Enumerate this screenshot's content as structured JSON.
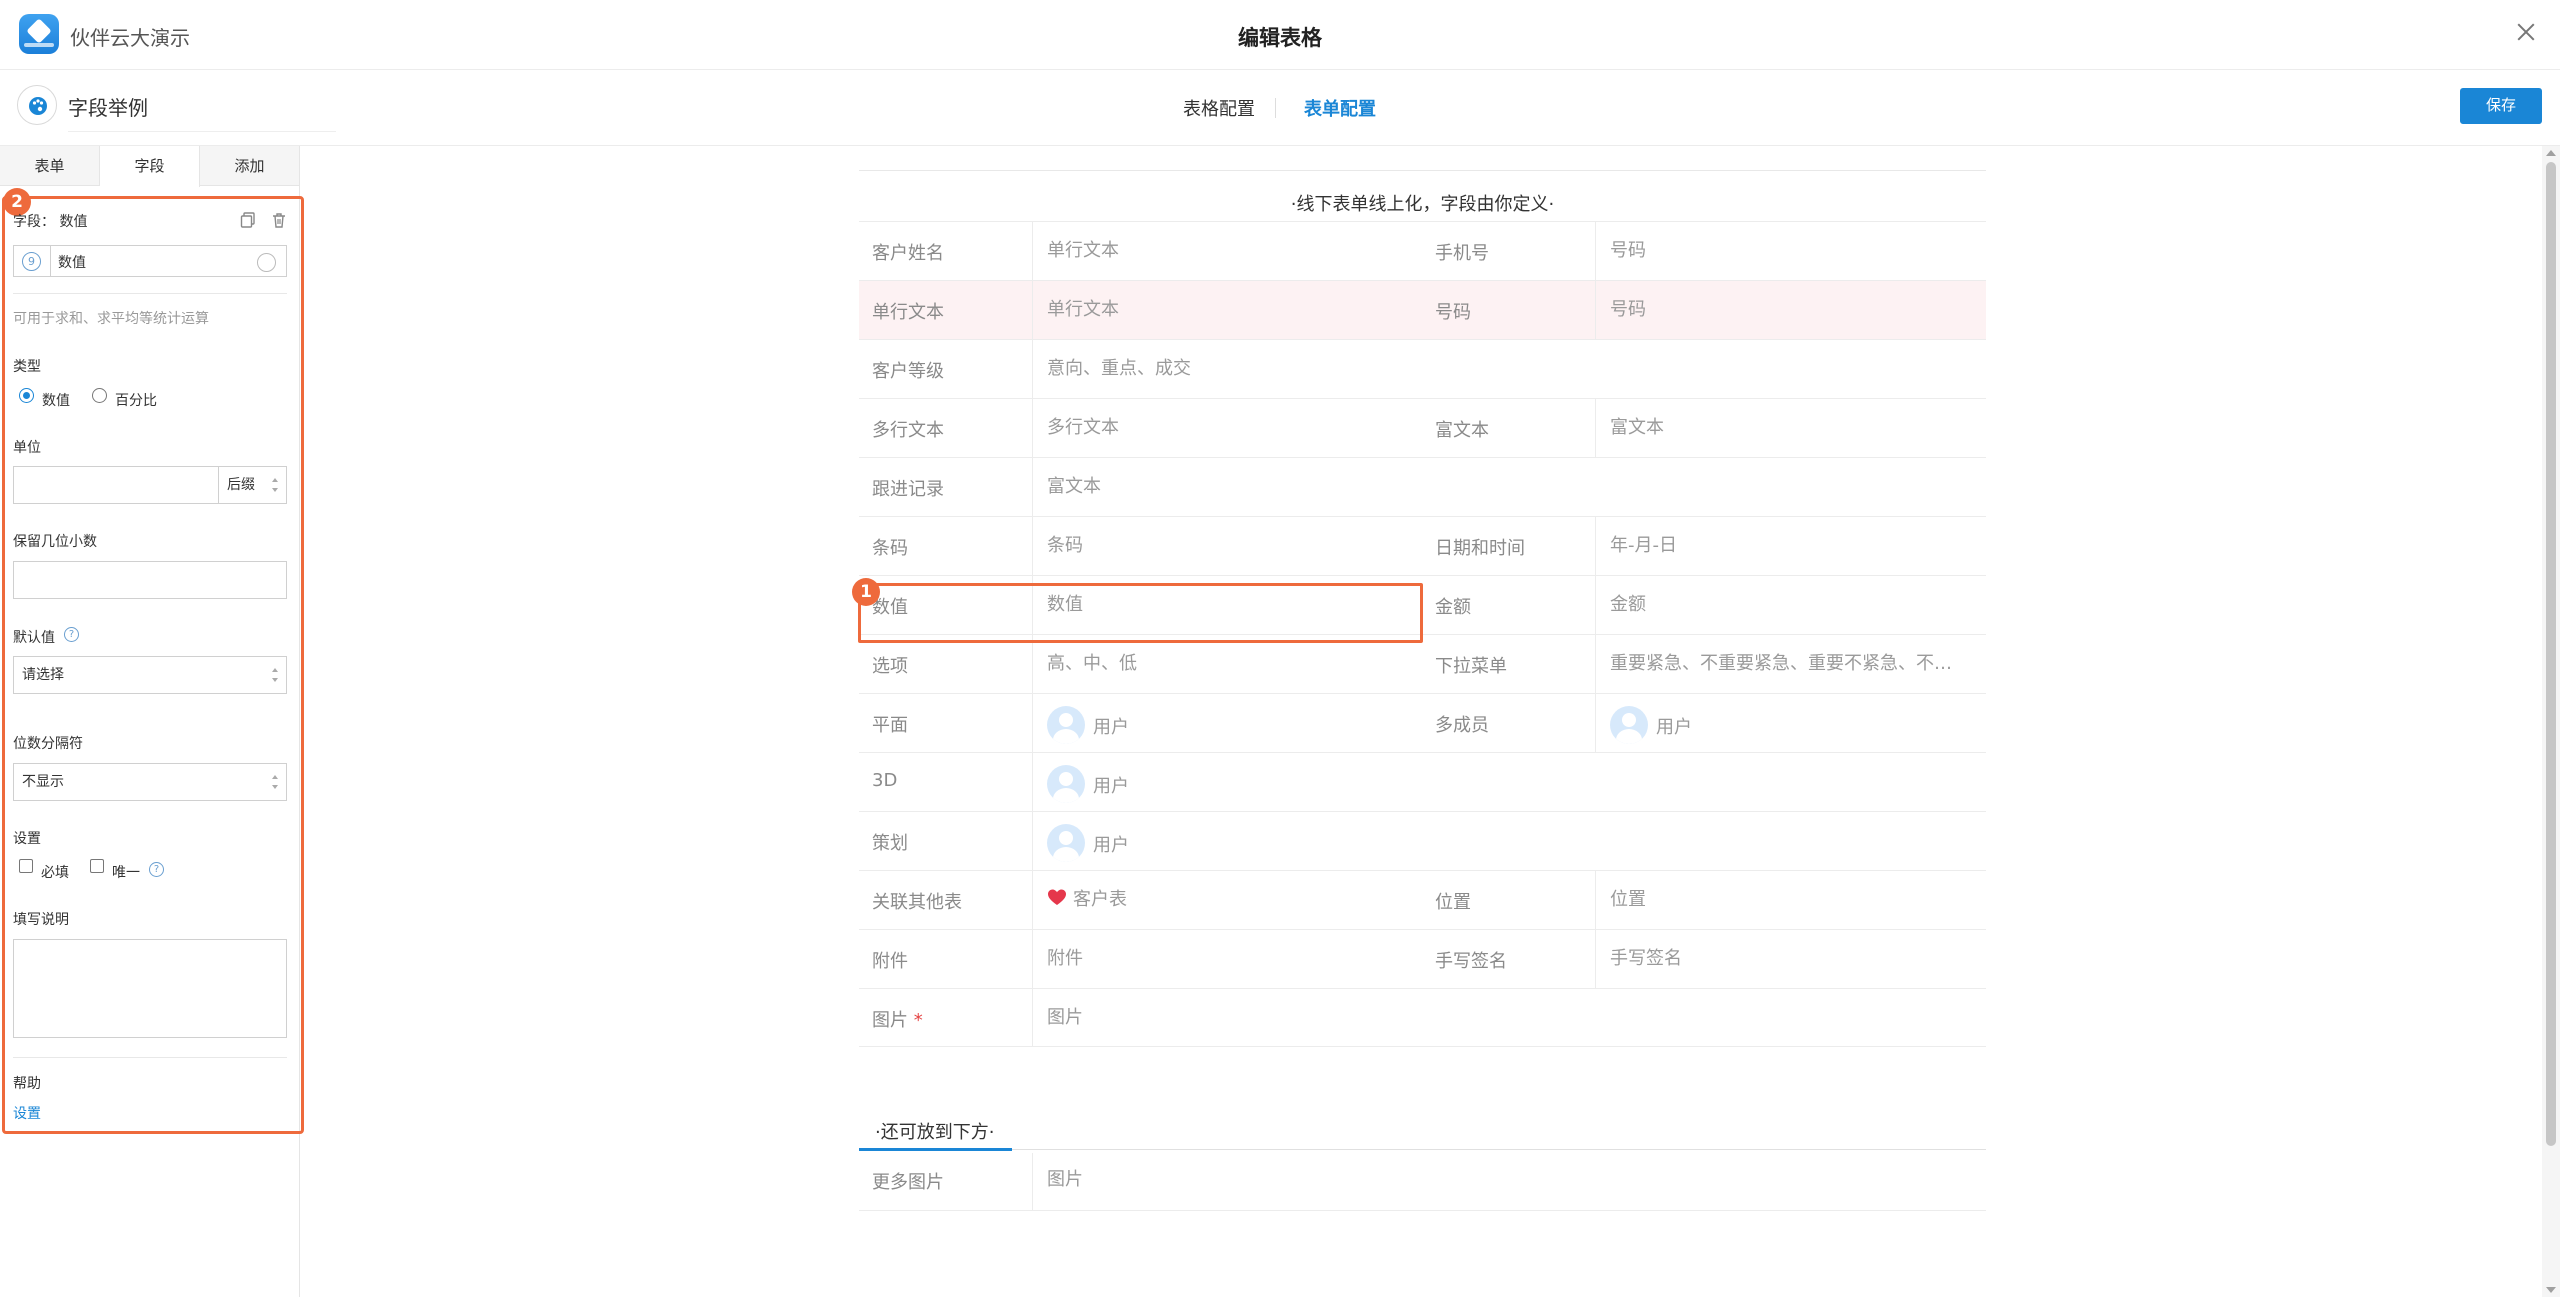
{
  "app": {
    "name": "伙伴云大演示",
    "window_title": "编辑表格"
  },
  "form": {
    "name": "字段举例"
  },
  "mode_tabs": [
    {
      "label": "表格配置"
    },
    {
      "label": "表单配置"
    }
  ],
  "save_label": "保存",
  "panel_tabs": [
    {
      "label": "表单"
    },
    {
      "label": "字段"
    },
    {
      "label": "添加"
    }
  ],
  "field_panel": {
    "badge": "2",
    "field_heading": "字段：  数值",
    "field_name": "数值",
    "field_type_glyph": "9",
    "hint": "可用于求和、求平均等统计运算",
    "type_label": "类型",
    "type_options": [
      {
        "label": "数值",
        "checked": true
      },
      {
        "label": "百分比",
        "checked": false
      }
    ],
    "unit_label": "单位",
    "unit_value": "",
    "unit_position": "后缀",
    "decimals_label": "保留几位小数",
    "decimals_value": "",
    "default_label": "默认值",
    "default_value": "请选择",
    "separator_label": "位数分隔符",
    "separator_value": "不显示",
    "settings_label": "设置",
    "settings_options": [
      {
        "label": "必填",
        "checked": false
      },
      {
        "label": "唯一",
        "checked": false
      }
    ],
    "description_label": "填写说明",
    "description_value": "",
    "help_label": "帮助",
    "help_link": "设置"
  },
  "section_title": "·线下表单线上化，字段由你定义·",
  "highlight_badge": "1",
  "rows": [
    {
      "cells": [
        {
          "label": "客户姓名",
          "value": "单行文本"
        },
        {
          "label": "手机号",
          "value": "号码"
        }
      ]
    },
    {
      "pink": true,
      "cells": [
        {
          "label": "单行文本",
          "value": "单行文本"
        },
        {
          "label": "号码",
          "value": "号码"
        }
      ]
    },
    {
      "cells": [
        {
          "label": "客户等级",
          "value": "意向、重点、成交"
        }
      ]
    },
    {
      "cells": [
        {
          "label": "多行文本",
          "value": "多行文本"
        },
        {
          "label": "富文本",
          "value": "富文本"
        }
      ]
    },
    {
      "cells": [
        {
          "label": "跟进记录",
          "value": "富文本"
        }
      ]
    },
    {
      "cells": [
        {
          "label": "条码",
          "value": "条码"
        },
        {
          "label": "日期和时间",
          "value": "年-月-日"
        }
      ]
    },
    {
      "cells": [
        {
          "label": "数值",
          "value": "数值"
        },
        {
          "label": "金额",
          "value": "金额"
        }
      ]
    },
    {
      "cells": [
        {
          "label": "选项",
          "value": "高、中、低"
        },
        {
          "label": "下拉菜单",
          "value": "重要紧急、不重要紧急、重要不紧急、不重要不紧急"
        }
      ]
    },
    {
      "cells": [
        {
          "label": "平面",
          "value": "用户",
          "avatar": true
        },
        {
          "label": "多成员",
          "value": "用户",
          "avatar": true
        }
      ]
    },
    {
      "cells": [
        {
          "label": "3D",
          "value": "用户",
          "avatar": true
        }
      ]
    },
    {
      "cells": [
        {
          "label": "策划",
          "value": "用户",
          "avatar": true
        }
      ]
    },
    {
      "cells": [
        {
          "label": "关联其他表",
          "value": "客户表",
          "heart": true
        },
        {
          "label": "位置",
          "value": "位置"
        }
      ]
    },
    {
      "cells": [
        {
          "label": "附件",
          "value": "附件"
        },
        {
          "label": "手写签名",
          "value": "手写签名"
        }
      ]
    },
    {
      "cells": [
        {
          "label": "图片",
          "value": "图片",
          "required": true
        }
      ]
    }
  ],
  "below_section": {
    "title": "·还可放到下方·",
    "row": {
      "label": "更多图片",
      "value": "图片"
    }
  },
  "colors": {
    "accent": "#1a86d6",
    "highlight": "#ee6a3c",
    "heart": "#e5374b",
    "pink_row": "#fdf2f3"
  }
}
